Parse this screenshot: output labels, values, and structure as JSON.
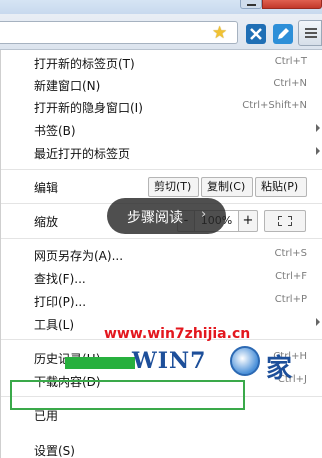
{
  "menu": {
    "items": [
      {
        "label": "打开新的标签页(T)",
        "shortcut": "Ctrl+T"
      },
      {
        "label": "新建窗口(N)",
        "shortcut": "Ctrl+N"
      },
      {
        "label": "打开新的隐身窗口(I)",
        "shortcut": "Ctrl+Shift+N"
      },
      {
        "label": "书签(B)",
        "shortcut": ""
      },
      {
        "label": "最近打开的标签页",
        "shortcut": ""
      }
    ],
    "edit": {
      "label": "编辑",
      "cut": "剪切(T)",
      "copy": "复制(C)",
      "paste": "粘贴(P)"
    },
    "zoom": {
      "label": "缩放",
      "minus": "-",
      "value": "100%",
      "plus": "+"
    },
    "page_items": [
      {
        "label": "网页另存为(A)...",
        "shortcut": "Ctrl+S"
      },
      {
        "label": "查找(F)...",
        "shortcut": "Ctrl+F"
      },
      {
        "label": "打印(P)...",
        "shortcut": "Ctrl+P"
      },
      {
        "label": "工具(L)",
        "shortcut": ""
      }
    ],
    "history_items": [
      {
        "label": "历史记录(H)",
        "shortcut": "Ctrl+H"
      },
      {
        "label": "下载内容(D)",
        "shortcut": "Ctrl+J"
      }
    ],
    "signed_in_label": "已用",
    "settings_label": "设置(S)"
  },
  "overlay": {
    "text": "步骤阅读",
    "chevron": "›"
  },
  "watermark": {
    "url": "www.win7zhijia.cn",
    "logo": "WIN7",
    "jia": "家"
  },
  "icons": {
    "bookmark_star": "★",
    "extension_x": "x-app-icon",
    "extension_pen": "pen-icon",
    "menu": "hamburger-icon"
  },
  "colors": {
    "highlight": "#3aa94a",
    "usage_bar": "#27b03e",
    "watermark_red": "#e3171e",
    "watermark_blue": "#1d4f9a"
  }
}
